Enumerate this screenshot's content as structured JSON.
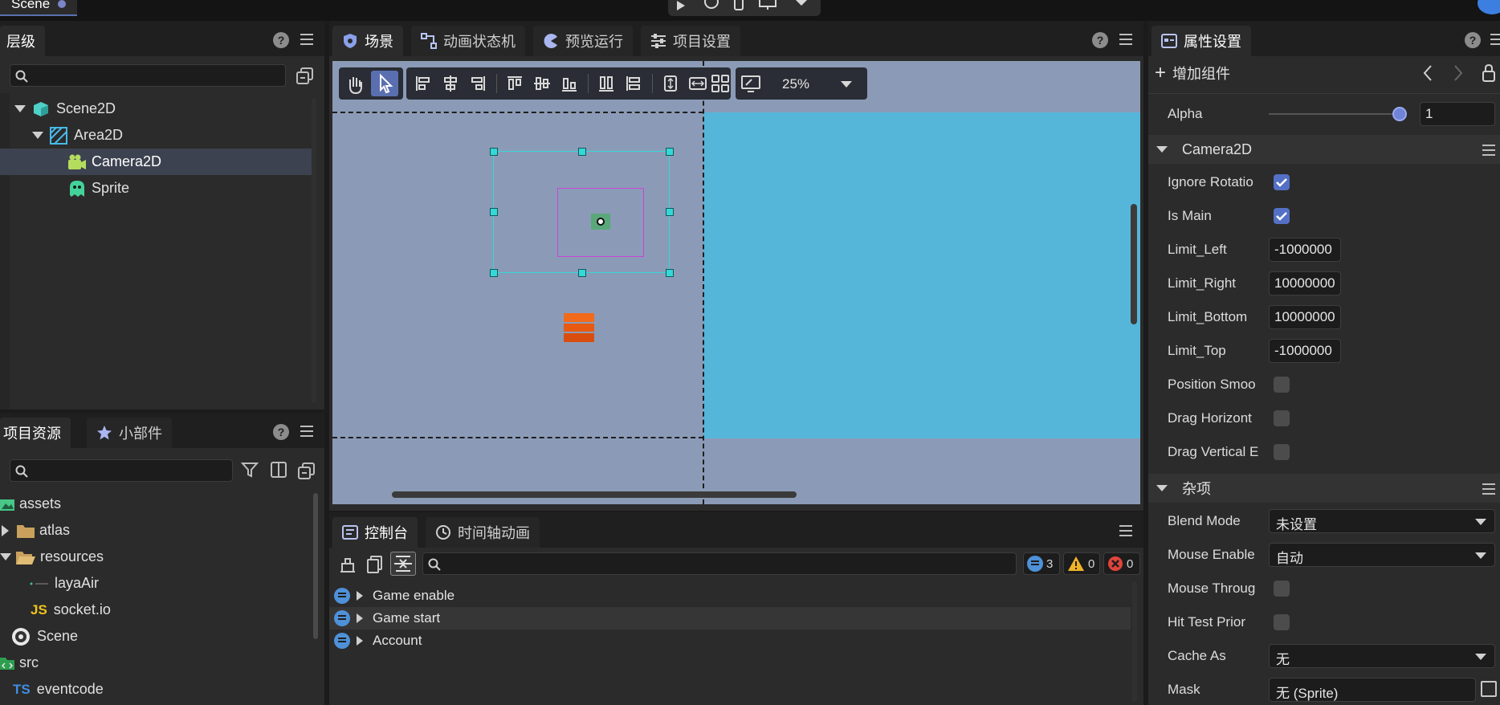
{
  "top": {
    "scene_tab": "Scene"
  },
  "hierarchy": {
    "tab": "层级",
    "items": [
      {
        "label": "Scene2D"
      },
      {
        "label": "Area2D"
      },
      {
        "label": "Camera2D"
      },
      {
        "label": "Sprite"
      }
    ]
  },
  "assets_panel": {
    "tabs": [
      "项目资源",
      "小部件"
    ],
    "items": [
      {
        "label": "assets"
      },
      {
        "label": "atlas"
      },
      {
        "label": "resources"
      },
      {
        "label": "layaAir"
      },
      {
        "label": "socket.io",
        "badge": "JS"
      },
      {
        "label": "Scene"
      },
      {
        "label": "src"
      },
      {
        "label": "eventcode",
        "badge": "TS"
      }
    ]
  },
  "center": {
    "tabs": [
      "场景",
      "动画状态机",
      "预览运行",
      "项目设置"
    ],
    "zoom": "25%",
    "colors": {
      "canvas_bg": "#8b9bb7",
      "scene_area": "#56b6d9",
      "selection": "#35d7d7",
      "camera_box": "#c944d6",
      "sprite": "#f26a1b"
    }
  },
  "console": {
    "tabs": [
      "控制台",
      "时间轴动画"
    ],
    "counts": {
      "info": "3",
      "warn": "0",
      "error": "0"
    },
    "logs": [
      "Game enable",
      "Game start",
      "Account"
    ]
  },
  "inspector": {
    "tab": "属性设置",
    "add_component": "增加组件",
    "alpha": {
      "label": "Alpha",
      "value": "1",
      "level": 1.0
    },
    "camera_section": "Camera2D",
    "camera_props": [
      {
        "label": "Ignore Rotatio",
        "type": "check",
        "checked": true
      },
      {
        "label": "Is Main",
        "type": "check",
        "checked": true
      },
      {
        "label": "Limit_Left",
        "type": "number",
        "value": "-1000000"
      },
      {
        "label": "Limit_Right",
        "type": "number",
        "value": "10000000"
      },
      {
        "label": "Limit_Bottom",
        "type": "number",
        "value": "10000000"
      },
      {
        "label": "Limit_Top",
        "type": "number",
        "value": "-1000000"
      },
      {
        "label": "Position Smoo",
        "type": "check",
        "checked": false
      },
      {
        "label": "Drag Horizont",
        "type": "check",
        "checked": false
      },
      {
        "label": "Drag Vertical E",
        "type": "check",
        "checked": false
      }
    ],
    "misc_section": "杂项",
    "misc_props": [
      {
        "label": "Blend Mode",
        "type": "select",
        "value": "未设置"
      },
      {
        "label": "Mouse Enable",
        "type": "select",
        "value": "自动"
      },
      {
        "label": "Mouse Throug",
        "type": "check",
        "checked": false
      },
      {
        "label": "Hit Test Prior",
        "type": "check",
        "checked": false
      },
      {
        "label": "Cache As",
        "type": "select",
        "value": "无"
      },
      {
        "label": "Mask",
        "type": "select",
        "value": "无 (Sprite)"
      }
    ]
  }
}
